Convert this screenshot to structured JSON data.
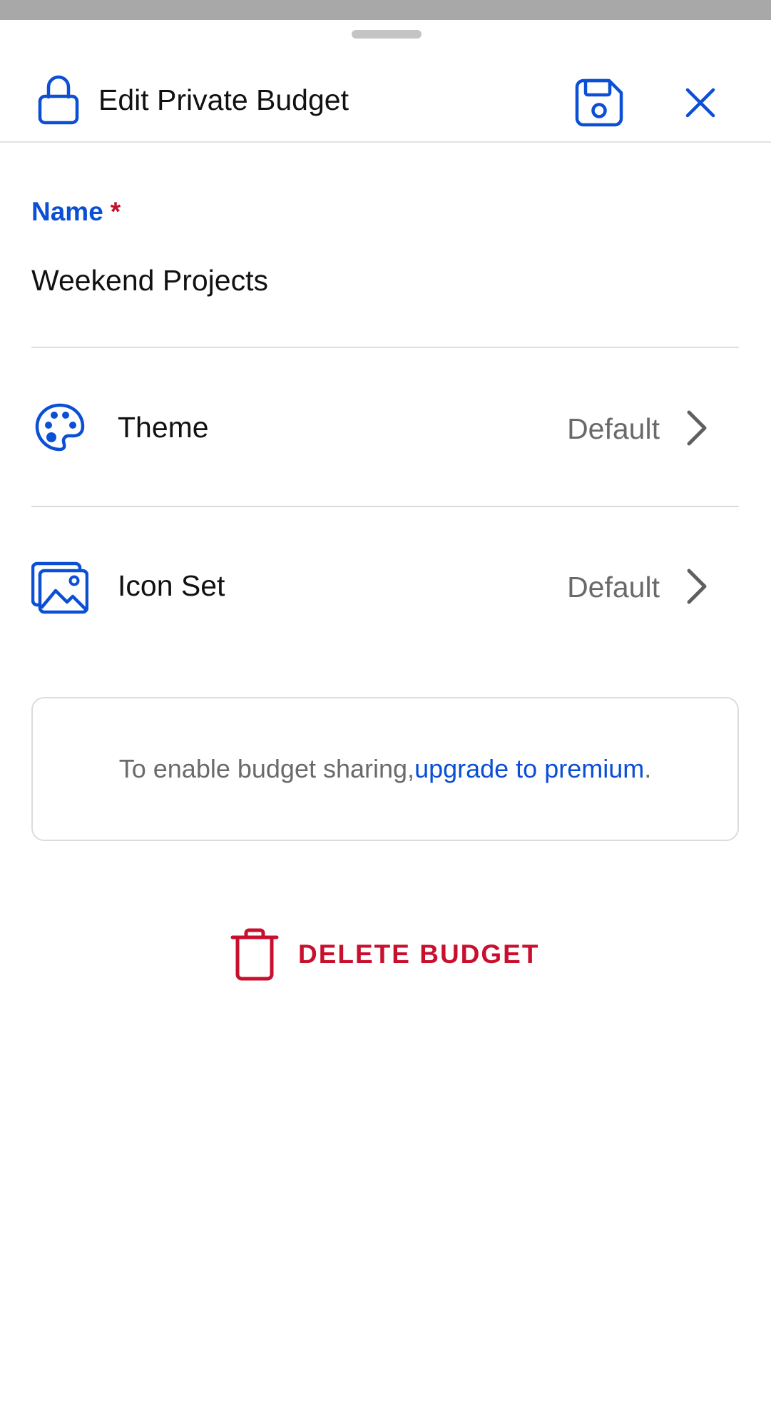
{
  "header": {
    "title": "Edit Private Budget",
    "icons": {
      "lock": "lock-icon",
      "save": "save-icon",
      "close": "close-icon"
    }
  },
  "form": {
    "name_label": "Name",
    "required_marker": "*",
    "name_value": "Weekend Projects"
  },
  "settings": [
    {
      "label": "Theme",
      "value": "Default",
      "icon": "palette-icon"
    },
    {
      "label": "Icon Set",
      "value": "Default",
      "icon": "images-icon"
    }
  ],
  "notice": {
    "text": "To enable budget sharing, ",
    "link_text": "upgrade to premium",
    "suffix": "."
  },
  "delete": {
    "label": "DELETE BUDGET",
    "icon": "trash-icon"
  },
  "colors": {
    "accent": "#0a4fd4",
    "danger": "#c8102e",
    "required": "#c0102a",
    "muted_text": "#6a6a6a",
    "divider": "#dcdcdc"
  }
}
